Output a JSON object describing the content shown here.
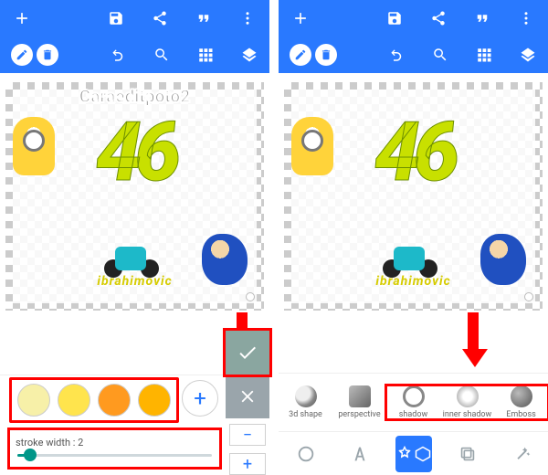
{
  "watermark": "Caraeditpoto2",
  "artwork_text": "46",
  "artwork_name": "ibrahimovic",
  "stroke": {
    "label": "stroke width : ",
    "value": 2,
    "max": 30
  },
  "swatches": [
    "#f7f0a8",
    "#ffe44d",
    "#ff9a1f",
    "#ffb400"
  ],
  "effects": [
    {
      "label": "3d shape",
      "style": "background:radial-gradient(circle at 35% 35%,#eee 0 8px,#888 60%,#555)"
    },
    {
      "label": "perspective",
      "style": "background:linear-gradient(135deg,#bbb,#666);border-radius:4px"
    },
    {
      "label": "shadow",
      "style": "border:3px solid #888;background:#fff"
    },
    {
      "label": "inner shadow",
      "style": "background:radial-gradient(circle at 50% 50%,#fff 30%,#888)"
    },
    {
      "label": "Emboss",
      "style": "background:radial-gradient(circle at 35% 35%,#bbb,#555)"
    }
  ],
  "highlight_effects_from": 2,
  "colors": {
    "accent": "#2979ff",
    "annotate": "#ff0000"
  }
}
